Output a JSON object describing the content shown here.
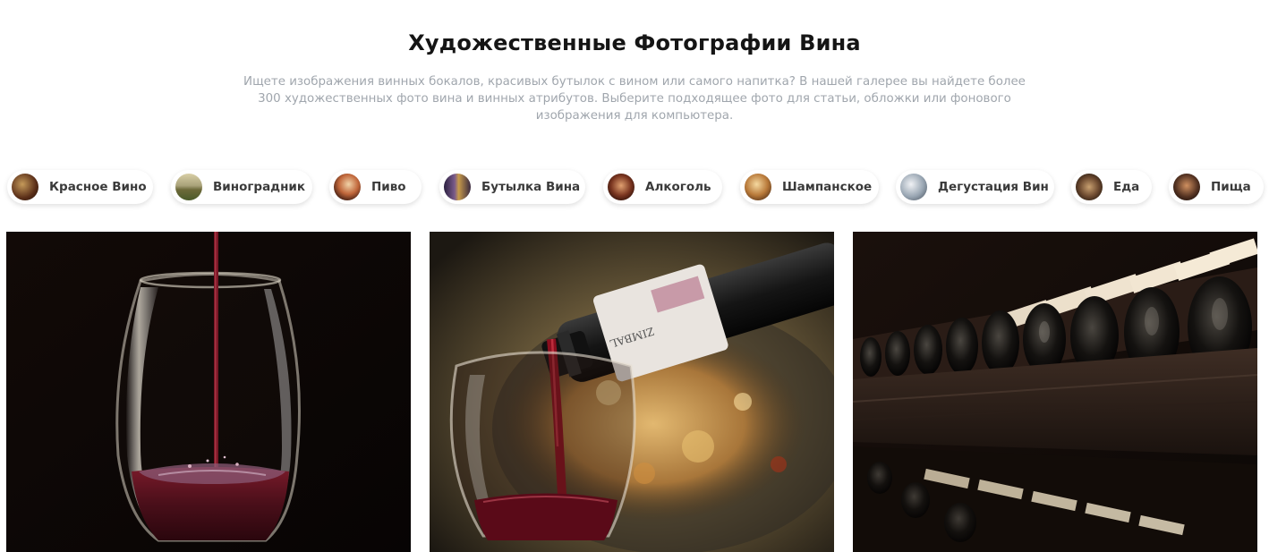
{
  "header": {
    "title": "Художественные Фотографии Вина",
    "description": "Ищете изображения винных бокалов, красивых бутылок с вином или самого напитка? В нашей галерее вы найдете более 300 художественных фото вина и винных атрибутов. Выберите подходящее фото для статьи, обложки или фонового изображения для компьютера."
  },
  "categories": [
    {
      "label": "Красное Вино",
      "color": "#6b3a22"
    },
    {
      "label": "Виноградник",
      "color": "#9a8a55"
    },
    {
      "label": "Пиво",
      "color": "#a0522d"
    },
    {
      "label": "Бутылка Вина",
      "color": "#4a3558"
    },
    {
      "label": "Алкоголь",
      "color": "#5a2a1a"
    },
    {
      "label": "Шампанское",
      "color": "#b07a3a"
    },
    {
      "label": "Дегустация Вин",
      "color": "#8a97a3"
    },
    {
      "label": "Еда",
      "color": "#6d4a30"
    },
    {
      "label": "Пища",
      "color": "#553322"
    }
  ],
  "photos": [
    {
      "subject": "wine-pouring-into-glass-photo"
    },
    {
      "subject": "bottle-pouring-wine-photo"
    },
    {
      "subject": "wine-cellar-bottles-photo"
    }
  ]
}
